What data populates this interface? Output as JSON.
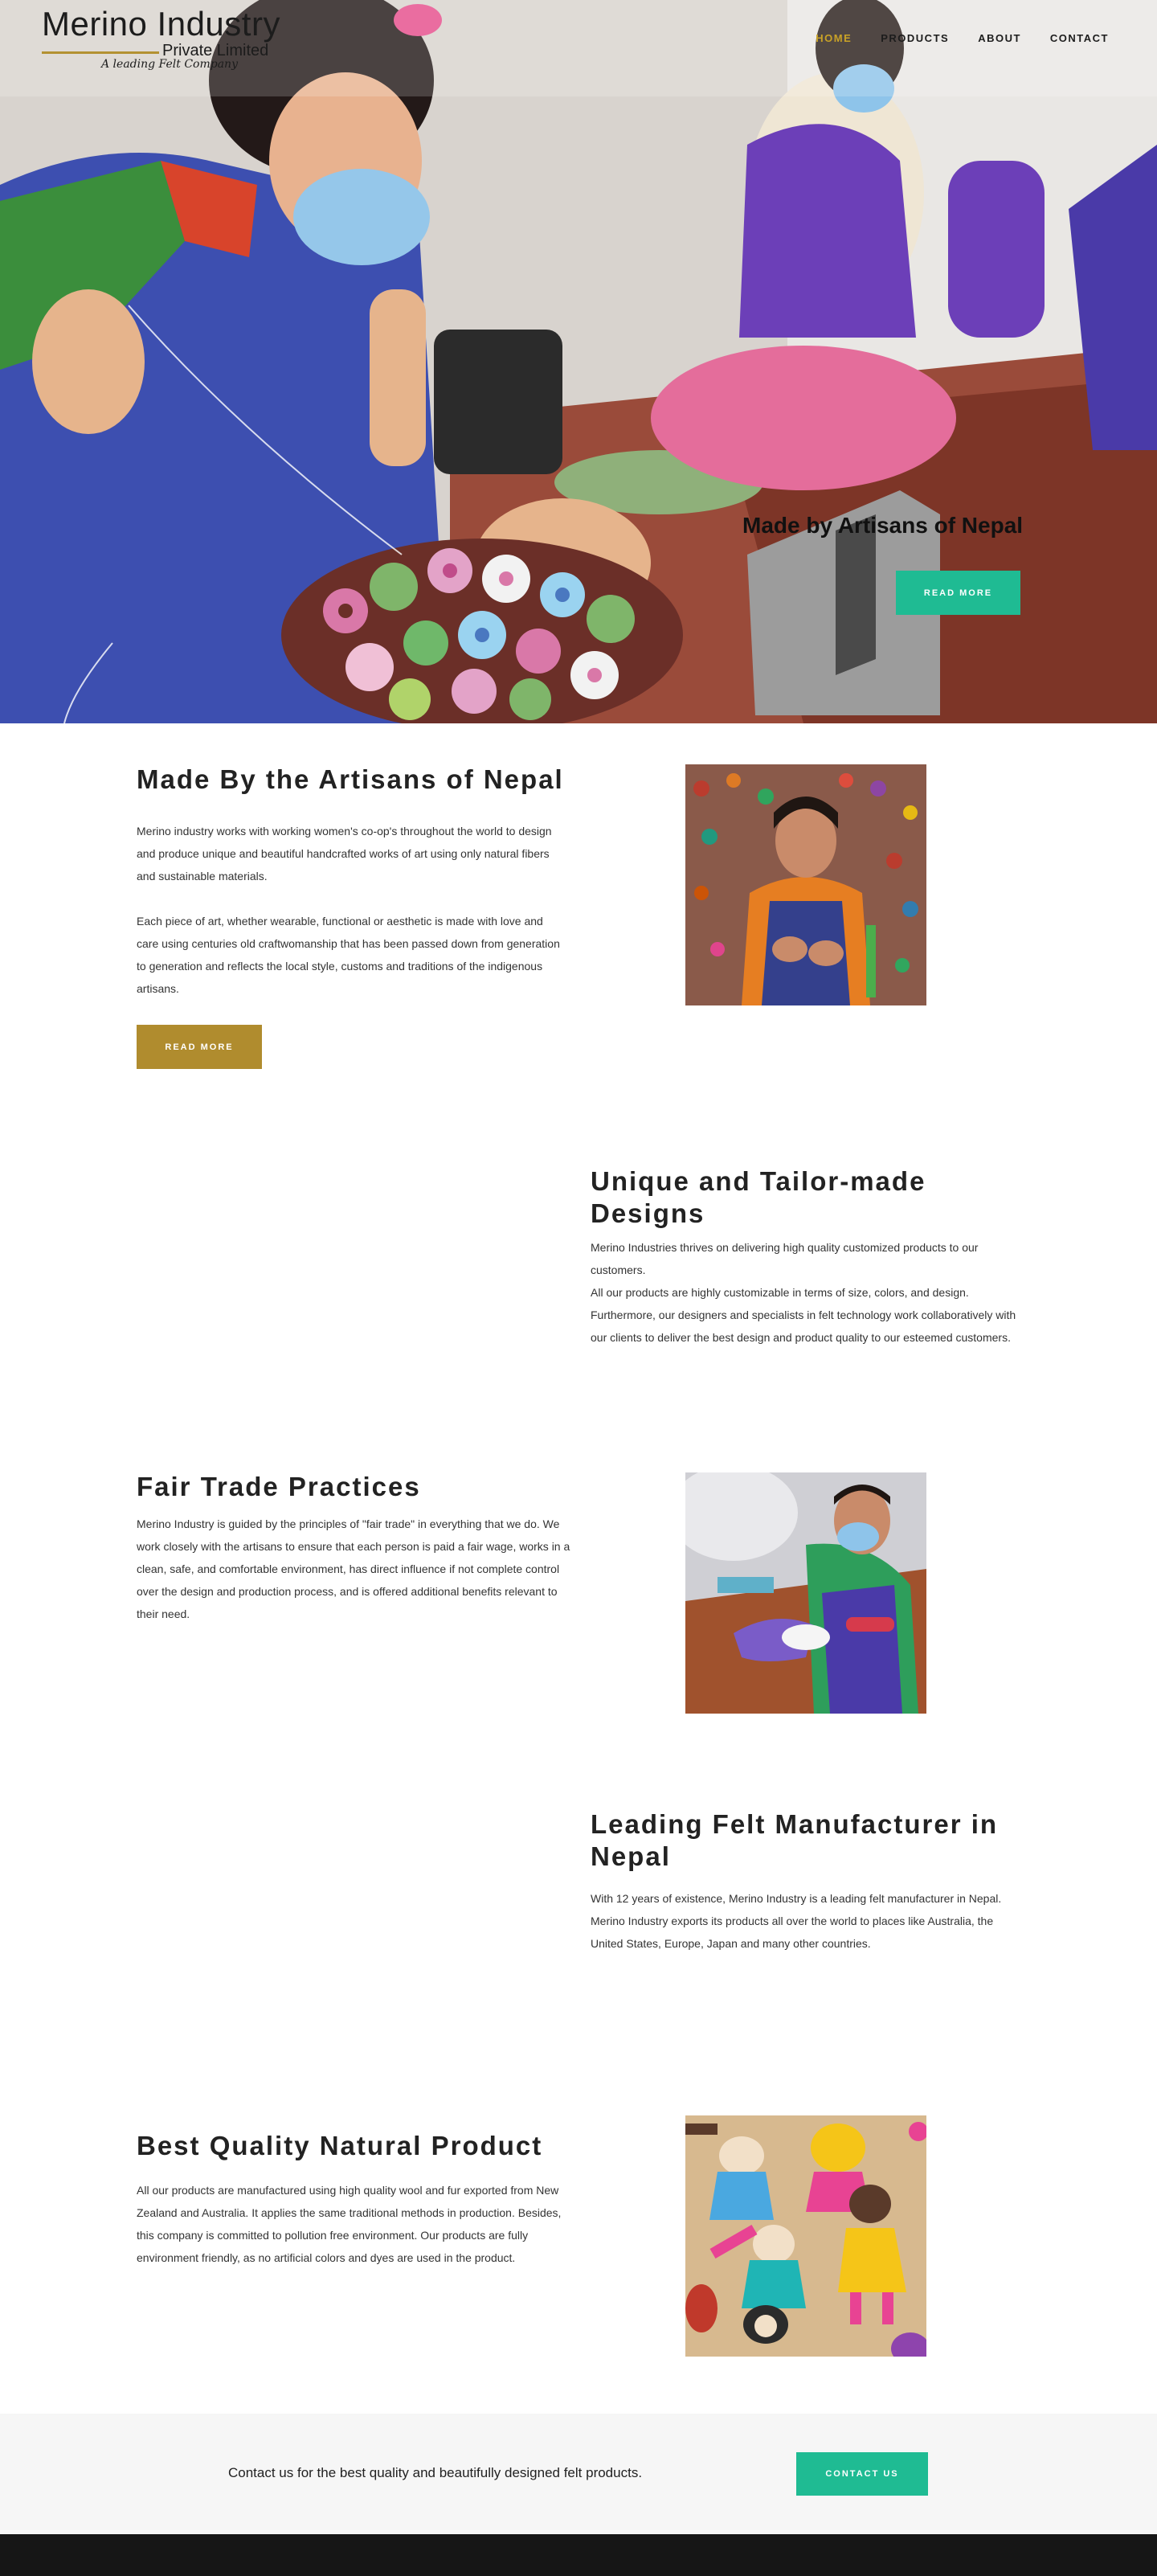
{
  "brand": {
    "name": "Merino Industry",
    "subtitle": "Private Limited",
    "tagline": "A leading Felt Company"
  },
  "nav": {
    "items": [
      {
        "label": "HOME",
        "active": true
      },
      {
        "label": "PRODUCTS",
        "active": false
      },
      {
        "label": "ABOUT",
        "active": false
      },
      {
        "label": "CONTACT",
        "active": false
      }
    ]
  },
  "hero": {
    "caption": "Made by Artisans of Nepal",
    "button": "READ MORE"
  },
  "sections": [
    {
      "title": "Made By the Artisans of Nepal",
      "paragraphs": [
        "Merino industry works with working women's co-op's throughout the world to design and produce unique and beautiful handcrafted works of art using only natural fibers and sustainable materials.",
        "Each piece of art, whether wearable, functional or aesthetic is made with love and care using centuries old craftwomanship that has been passed down from generation to generation and reflects the local style, customs and traditions of the indigenous artisans."
      ],
      "button": "READ MORE"
    },
    {
      "title": "Unique and Tailor-made Designs",
      "paragraphs": [
        "Merino Industries thrives on delivering high quality customized products to our customers.",
        "All our products are highly customizable in terms of size, colors, and design. Furthermore, our designers and specialists in felt technology work collaboratively with our clients to deliver the best design and product quality to our esteemed customers."
      ]
    },
    {
      "title": "Fair Trade Practices",
      "paragraphs": [
        "Merino Industry is guided by the principles of \"fair trade\" in everything that we do. We work closely with the artisans to ensure that each person is paid a fair wage, works in a clean, safe, and comfortable environment, has direct influence if not complete control over the design and production process, and is offered additional benefits relevant to their need."
      ]
    },
    {
      "title": "Leading Felt Manufacturer in Nepal",
      "paragraphs": [
        "With 12 years of existence, Merino Industry is a leading felt manufacturer in Nepal. Merino Industry exports its products all over the world to places like Australia, the United States, Europe, Japan and many other countries."
      ]
    },
    {
      "title": "Best Quality Natural Product",
      "paragraphs": [
        "All our products are manufactured using high quality wool and fur exported from New Zealand and Australia. It applies the same traditional methods in production. Besides, this company is committed to pollution free environment. Our products are fully environment friendly, as no artificial colors and dyes are used in the product."
      ]
    }
  ],
  "cta": {
    "text": "Contact us for the best quality and beautifully designed felt products.",
    "button": "CONTACT US"
  },
  "colors": {
    "accent_teal": "#1fbb93",
    "accent_gold": "#b08c2e",
    "nav_active": "#c9a227",
    "footer": "#161616"
  }
}
